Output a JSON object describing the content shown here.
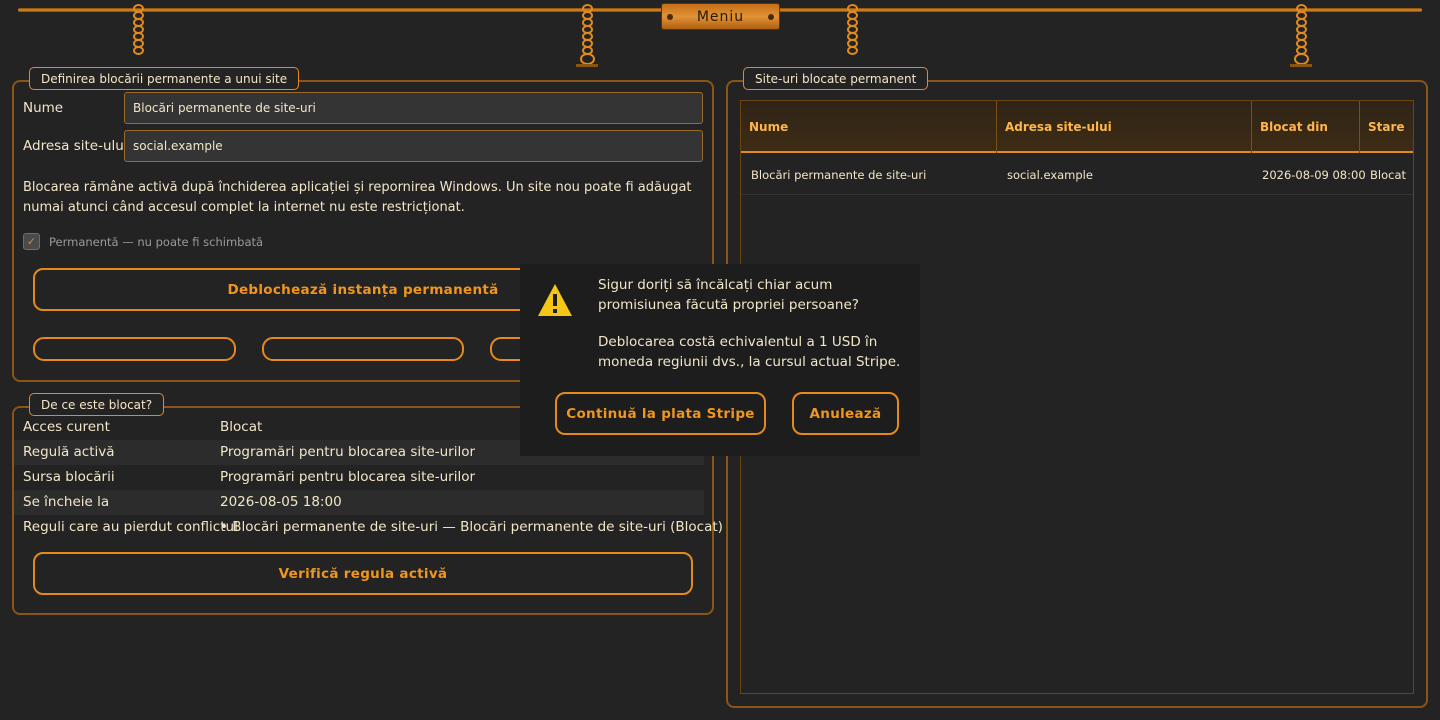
{
  "menu": {
    "label": "Meniu"
  },
  "define_panel": {
    "legend": "Definirea blocării permanente a unui site",
    "name_label": "Nume",
    "name_value": "Blocări permanente de site-uri",
    "address_label": "Adresa site-ului",
    "address_value": "social.example",
    "description": "Blocarea rămâne activă după închiderea aplicației și repornirea Windows. Un site nou poate fi adăugat numai atunci când accesul complet la internet nu este restricționat.",
    "permanent_checkbox_label": "Permanentă — nu poate fi schimbată",
    "permanent_checked": true,
    "unlock_button": "Deblochează instanța permanentă"
  },
  "why_panel": {
    "legend": "De ce este blocat?",
    "rows": [
      {
        "key": "Acces curent",
        "value": "Blocat"
      },
      {
        "key": "Regulă activă",
        "value": "Programări pentru blocarea site-urilor"
      },
      {
        "key": "Sursa blocării",
        "value": "Programări pentru blocarea site-urilor"
      },
      {
        "key": "Se încheie la",
        "value": "2026-08-05 18:00"
      },
      {
        "key": "Reguli care au pierdut conflictul",
        "value": "• Blocări permanente de site-uri — Blocări permanente de site-uri (Blocat)"
      }
    ],
    "check_button": "Verifică regula activă"
  },
  "blocked_panel": {
    "legend": "Site-uri blocate permanent",
    "columns": [
      "Nume",
      "Adresa site-ului",
      "Blocat din",
      "Stare"
    ],
    "rows": [
      [
        "Blocări permanente de site-uri",
        "social.example",
        "2026-08-09 08:00",
        "Blocat"
      ]
    ]
  },
  "dialog": {
    "question": "Sigur doriți să încălcați chiar acum promisiunea făcută propriei persoane?",
    "cost": "Deblocarea costă echivalentul a 1 USD în moneda regiunii dvs., la cursul actual Stripe.",
    "continue_button": "Continuă la plata Stripe",
    "cancel_button": "Anulează",
    "icon": "warning-icon"
  },
  "colors": {
    "accent": "#e5891e",
    "background": "#232323",
    "text": "#f2e6c9"
  }
}
